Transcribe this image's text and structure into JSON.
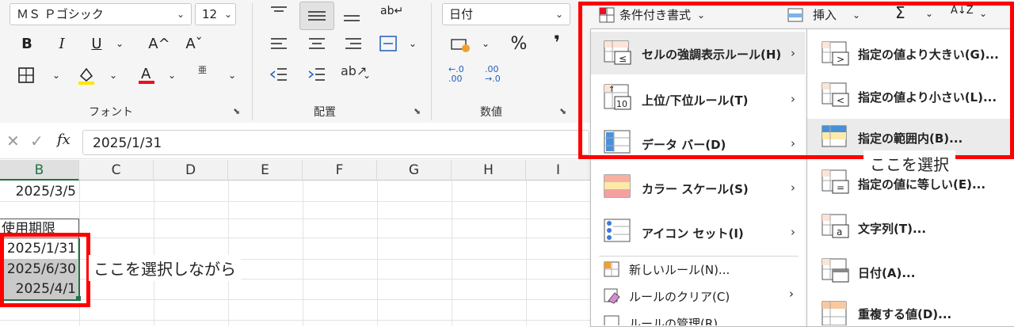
{
  "ribbon": {
    "font_name": "ＭＳ Ｐゴシック",
    "font_size": "12",
    "number_format": "日付",
    "font_group_label": "フォント",
    "align_group_label": "配置",
    "number_group_label": "数値",
    "bold": "B",
    "italic": "I",
    "underline": "U",
    "grow_font": "A^",
    "shrink_font": "Aˇ",
    "phonetic": "亜",
    "percent": "%",
    "comma": "❜",
    "cond_format": "条件付き書式",
    "insert": "挿入",
    "sum": "Σ",
    "sort": "A↓Z"
  },
  "formula_bar": {
    "fx": "fx",
    "value": "2025/1/31"
  },
  "columns": [
    "B",
    "C",
    "D",
    "E",
    "F",
    "G",
    "H",
    "I"
  ],
  "cells": {
    "b_row1": "2025/3/5",
    "b_header": "使用期限",
    "b_sel1": "2025/1/31",
    "b_sel2": "2025/6/30",
    "b_sel3": "2025/4/1"
  },
  "menu": {
    "items": [
      {
        "label": "セルの強調表示ルール(H)"
      },
      {
        "label": "上位/下位ルール(T)"
      },
      {
        "label": "データ バー(D)"
      },
      {
        "label": "カラー スケール(S)"
      },
      {
        "label": "アイコン セット(I)"
      },
      {
        "label": "新しいルール(N)..."
      },
      {
        "label": "ルールのクリア(C)"
      },
      {
        "label": "ルールの管理(R)..."
      }
    ]
  },
  "submenu": {
    "items": [
      {
        "label": "指定の値より大きい(G)..."
      },
      {
        "label": "指定の値より小さい(L)..."
      },
      {
        "label": "指定の範囲内(B)..."
      },
      {
        "label": "指定の値に等しい(E)..."
      },
      {
        "label": "文字列(T)..."
      },
      {
        "label": "日付(A)..."
      },
      {
        "label": "重複する値(D)..."
      }
    ]
  },
  "annotations": {
    "select_while": "ここを選択しながら",
    "select_here": "ここを選択"
  },
  "colors": {
    "highlight_red": "#ff0000",
    "menu_hover": "#ebebeb",
    "selection_gray": "#c9c9c9"
  }
}
